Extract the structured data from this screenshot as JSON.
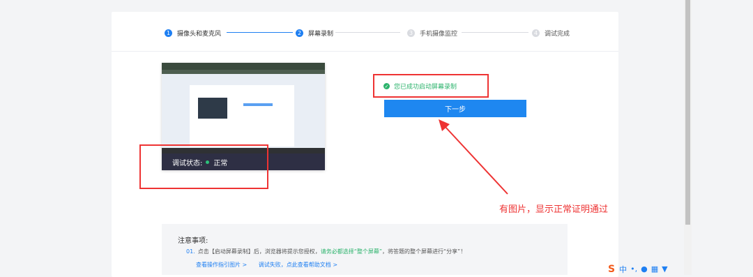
{
  "steps": [
    {
      "num": "1",
      "label": "摄像头和麦克风"
    },
    {
      "num": "2",
      "label": "屏幕录制"
    },
    {
      "num": "3",
      "label": "手机摄像监控"
    },
    {
      "num": "4",
      "label": "调试完成"
    }
  ],
  "preview": {
    "status_label": "调试状态:",
    "status_value": "正常"
  },
  "success_text": "您已成功启动屏幕录制",
  "next_button": "下一步",
  "annotation": "有图片，显示正常证明通过",
  "notice": {
    "title": "注意事项:",
    "item_num": "01.",
    "item_a": "点击【启动屏幕录制】后，浏览器将提示您授权，",
    "item_b": "请务必都选择“整个屏幕”",
    "item_c": "，将答题的整个屏幕进行“分享”！",
    "link1": "查看操作指引图片 >",
    "link2": "调试失败，点此查看帮助文档 >"
  },
  "ime": {
    "logo": "S",
    "lang": "中",
    "punct": "•,"
  },
  "colors": {
    "accent": "#1e7ff2",
    "success": "#2cb36c",
    "annotation": "#e33333"
  }
}
